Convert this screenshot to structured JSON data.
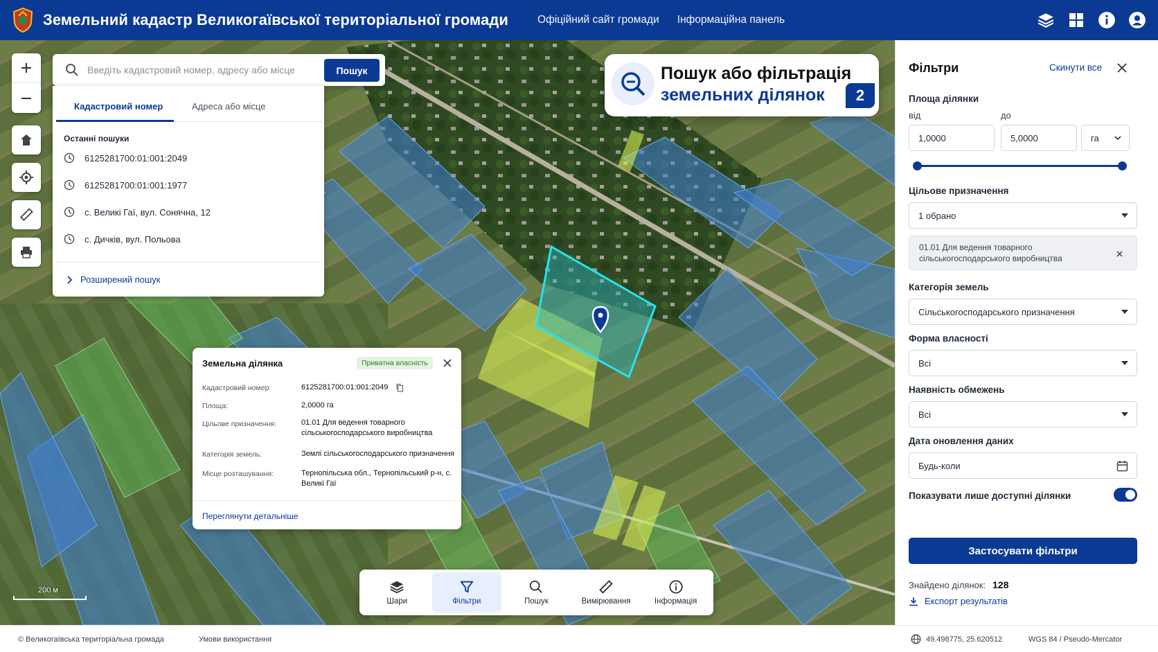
{
  "header": {
    "title": "Земельний кадастр Великогаївської територіальної громади",
    "nav": [
      "Офіційний сайт громади",
      "Інформаційна панель"
    ],
    "icons": [
      "layers-icon",
      "grid-icon",
      "info-icon",
      "user-icon"
    ],
    "brand_color": "#0b3a94"
  },
  "search": {
    "placeholder": "Введіть кадастровий номер, адресу або місце",
    "button": "Пошук",
    "tabs": [
      "Кадастровий номер",
      "Адреса або місце"
    ],
    "recent_title": "Останні пошуки",
    "recent": [
      "6125281700:01:001:2049",
      "6125281700:01:001:1977",
      "с. Великі Гаї, вул. Сонячна, 12",
      "с. Дичків, вул. Польова"
    ],
    "advanced": "Розширений пошук"
  },
  "promo": {
    "line1": "Пошук або фільтрація",
    "line2": "земельних ділянок",
    "step": "2"
  },
  "popup": {
    "title": "Земельна ділянка",
    "badge": "Приватна власність",
    "rows": [
      {
        "label": "Кадастровий номер:",
        "value": "6125281700:01:001:2049"
      },
      {
        "label": "Площа:",
        "value": "2,0000 га"
      },
      {
        "label": "Цільове призначення:",
        "value": "01.01 Для ведення товарного сільськогосподарського виробництва"
      },
      {
        "label": "Категорія земель:",
        "value": "Землі сільськогосподарського призначення"
      },
      {
        "label": "Місце розташування:",
        "value": "Тернопільська обл., Тернопільський р-н, с. Великі Гаї"
      }
    ],
    "link": "Переглянути детальніше"
  },
  "toolbar": {
    "items": [
      "Шари",
      "Фільтри",
      "Пошук",
      "Вимірювання",
      "Інформація"
    ],
    "active": "Фільтри"
  },
  "scale": "200 м",
  "filters": {
    "title": "Фільтри",
    "reset": "Скинути все",
    "area_label": "Площа ділянки",
    "from_label": "від",
    "to_label": "до",
    "area_from": "1,0000",
    "area_to": "5,0000",
    "unit": "га",
    "purpose_label": "Цільове призначення",
    "purpose_value": "1 обрано",
    "purpose_chip": "01.01 Для ведення товарного сільськогосподарського виробництва",
    "category_label": "Категорія земель",
    "category_value": "Сільськогосподарського призначення",
    "ownership_label": "Форма власності",
    "ownership_value": "Всі",
    "restrictions_label": "Наявність обмежень",
    "restrictions_value": "Всі",
    "date_label": "Дата оновлення даних",
    "date_value": "Будь-коли",
    "toggle_label": "Показувати лише доступні ділянки",
    "toggle_on": true,
    "apply": "Застосувати фільтри",
    "found_label": "Знайдено ділянок:",
    "found_count": "128",
    "export": "Експорт результатів"
  },
  "footer": {
    "copyright": "© Великогаївська територіальна громада",
    "terms": "Умови використання",
    "coords": "49.498775, 25.620512",
    "crs": "WGS 84 / Pseudo-Mercator"
  }
}
